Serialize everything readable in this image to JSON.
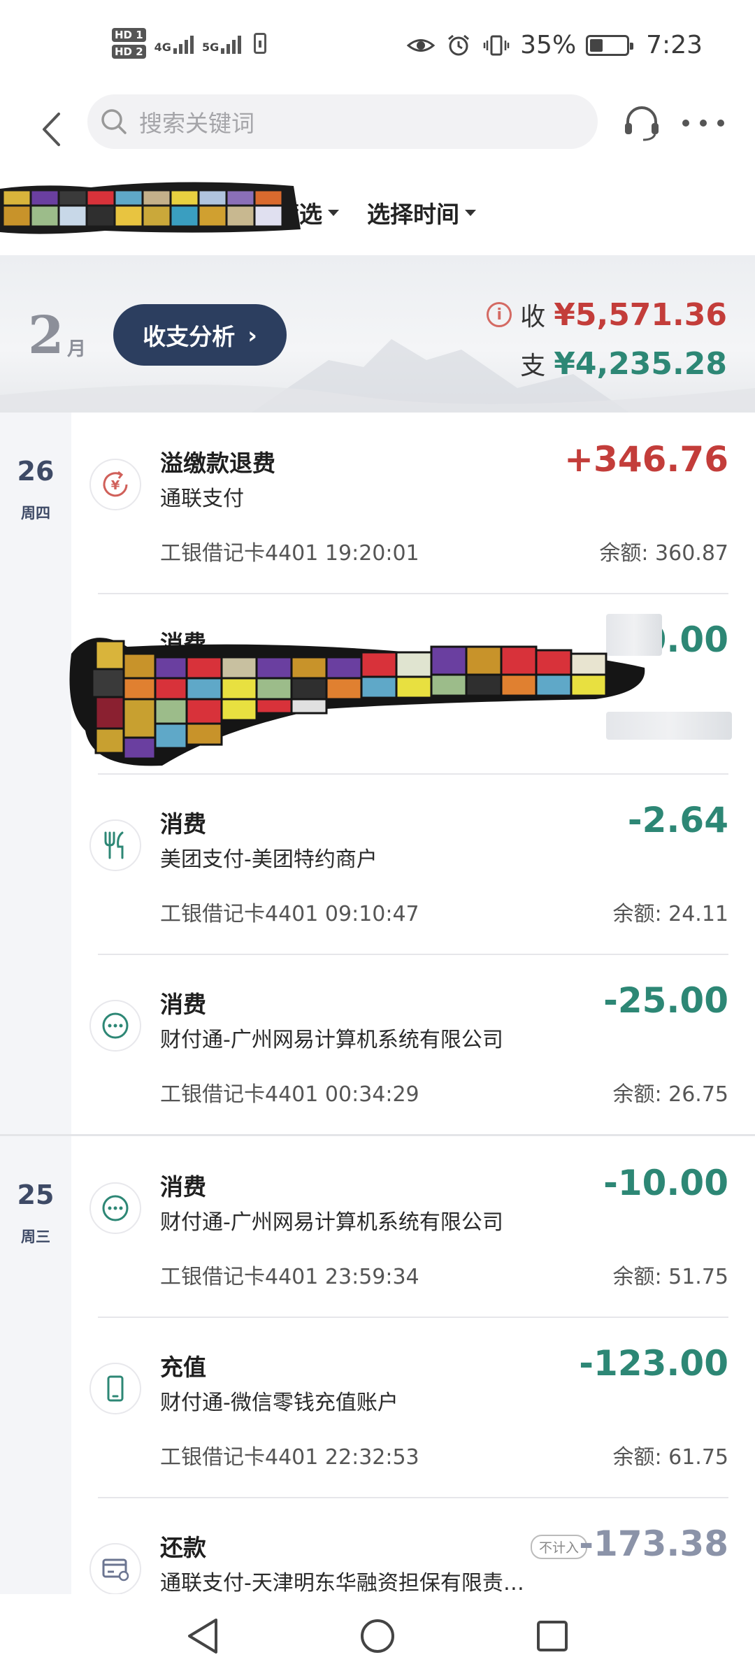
{
  "status_bar": {
    "hd1": "HD 1",
    "hd2": "HD 2",
    "net1": "4G",
    "net2": "5G",
    "battery_percent": "35%",
    "battery_level": 0.35,
    "time": "7:23",
    "icons": [
      "eye-icon",
      "alarm-icon",
      "vibrate-icon",
      "battery-icon"
    ]
  },
  "header": {
    "search_placeholder": "搜索关键词",
    "icons": [
      "back-arrow-icon",
      "search-icon",
      "headset-icon",
      "more-icon"
    ]
  },
  "filters": {
    "filter_label": "筛选",
    "filter_label_visible_fragment": "筛选",
    "time_label": "选择时间"
  },
  "banner": {
    "month": "2",
    "month_unit": "月",
    "analysis_button": "收支分析",
    "analysis_chevron": "›",
    "info_icon": "i",
    "income_label": "收",
    "income_total": "¥5,571.36",
    "expense_label": "支",
    "expense_total": "¥4,235.28",
    "colors": {
      "income": "#c33d3a",
      "expense": "#2d8775",
      "button": "#2c3e5f"
    }
  },
  "groups": [
    {
      "day": "26",
      "weekday": "周四",
      "transactions": [
        {
          "title": "溢缴款退费",
          "merchant": "通联支付",
          "card": "工银借记卡4401",
          "time": "19:20:01",
          "amount": "+346.76",
          "balance_label": "余额:",
          "balance": "360.87",
          "icon": "refund-yuan-icon",
          "kind": "income"
        },
        {
          "title": "消费",
          "merchant": "",
          "card": "",
          "time": "",
          "amount": "0.00",
          "balance_label": "",
          "balance": "",
          "icon": "",
          "kind": "redacted"
        },
        {
          "title": "消费",
          "merchant": "美团支付-美团特约商户",
          "card": "工银借记卡4401",
          "time": "09:10:47",
          "amount": "-2.64",
          "balance_label": "余额:",
          "balance": "24.11",
          "icon": "fork-knife-icon",
          "kind": "expense"
        },
        {
          "title": "消费",
          "merchant": "财付通-广州网易计算机系统有限公司",
          "card": "工银借记卡4401",
          "time": "00:34:29",
          "amount": "-25.00",
          "balance_label": "余额:",
          "balance": "26.75",
          "icon": "more-circle-icon",
          "kind": "expense"
        }
      ]
    },
    {
      "day": "25",
      "weekday": "周三",
      "transactions": [
        {
          "title": "消费",
          "merchant": "财付通-广州网易计算机系统有限公司",
          "card": "工银借记卡4401",
          "time": "23:59:34",
          "amount": "-10.00",
          "balance_label": "余额:",
          "balance": "51.75",
          "icon": "more-circle-icon",
          "kind": "expense"
        },
        {
          "title": "充值",
          "merchant": "财付通-微信零钱充值账户",
          "card": "工银借记卡4401",
          "time": "22:32:53",
          "amount": "-123.00",
          "balance_label": "余额:",
          "balance": "61.75",
          "icon": "phone-icon",
          "kind": "expense"
        },
        {
          "title": "还款",
          "merchant": "通联支付-天津明东华融资担保有限责…",
          "card": "",
          "time": "",
          "amount": "-173.38",
          "tag": "不计入",
          "icon": "card-repay-icon",
          "kind": "excluded"
        }
      ]
    }
  ],
  "navbar": {
    "icons": [
      "nav-back-icon",
      "nav-home-icon",
      "nav-recents-icon"
    ]
  }
}
